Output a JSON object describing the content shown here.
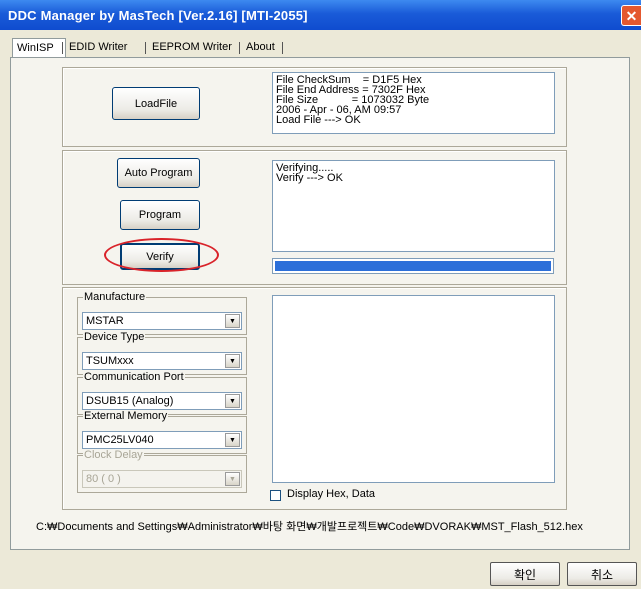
{
  "window": {
    "title": "DDC Manager  by MasTech  [Ver.2.16]  [MTI-2055]",
    "close_glyph": "✕"
  },
  "tabs": [
    {
      "label": "WinISP"
    },
    {
      "label": "EDID Writer"
    },
    {
      "label": "EEPROM Writer"
    },
    {
      "label": "About"
    }
  ],
  "load_section": {
    "load_button": "LoadFile",
    "info_text": "File CheckSum    = D1F5 Hex\nFile End Address = 7302F Hex\nFile Size           = 1073032 Byte\n2006 - Apr - 06, AM 09:57\nLoad File ---> OK"
  },
  "program_section": {
    "auto_program_button": "Auto Program",
    "program_button": "Program",
    "verify_button": "Verify",
    "log_text": "Verifying.....\nVerify ---> OK",
    "progress_fraction": 1.0,
    "progress_color": "#2c6fd9",
    "highlight_color": "#d9232a"
  },
  "settings": {
    "manufacture": {
      "label": "Manufacture",
      "value": "MSTAR"
    },
    "device_type": {
      "label": "Device Type",
      "value": "TSUMxxx"
    },
    "communication_port": {
      "label": "Communication Port",
      "value": "DSUB15 (Analog)"
    },
    "external_memory": {
      "label": "External Memory",
      "value": "PMC25LV040"
    },
    "clock_delay": {
      "label": "Clock Delay",
      "value": "80 ( 0 )"
    }
  },
  "output": {
    "display_hex_label": "Display Hex, Data",
    "display_hex_checked": false
  },
  "file_path": "C:₩Documents and Settings₩Administrator₩바탕 화면₩개발프로젝트₩Code₩DVORAK₩MST_Flash_512.hex",
  "dialog_buttons": {
    "ok": "확인",
    "cancel": "취소"
  }
}
